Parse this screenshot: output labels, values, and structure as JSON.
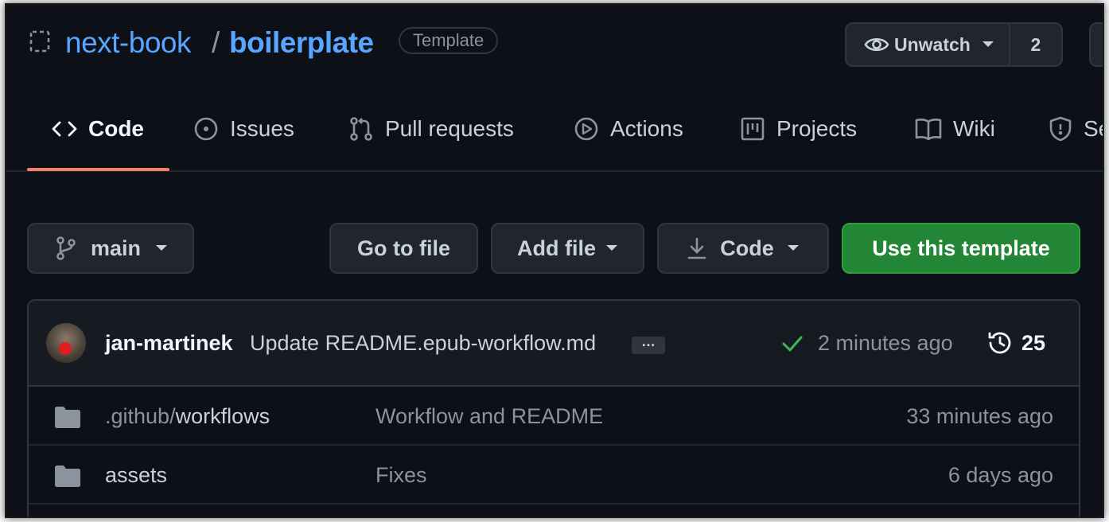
{
  "repo": {
    "owner": "next-book",
    "separator": "/",
    "name": "boilerplate",
    "badge": "Template"
  },
  "watch": {
    "label": "Unwatch",
    "count": "2"
  },
  "tabs": [
    {
      "label": "Code",
      "icon": "code-icon",
      "active": true
    },
    {
      "label": "Issues",
      "icon": "issue-icon"
    },
    {
      "label": "Pull requests",
      "icon": "pull-request-icon"
    },
    {
      "label": "Actions",
      "icon": "play-icon"
    },
    {
      "label": "Projects",
      "icon": "project-icon"
    },
    {
      "label": "Wiki",
      "icon": "book-icon"
    },
    {
      "label": "Se",
      "icon": "shield-icon"
    }
  ],
  "toolbar": {
    "branch": "main",
    "go_to_file": "Go to file",
    "add_file": "Add file",
    "code": "Code",
    "use_template": "Use this template"
  },
  "commit": {
    "author": "jan-martinek",
    "message": "Update README.epub-workflow.md",
    "ellipsis": "…",
    "time": "2 minutes ago",
    "history_count": "25"
  },
  "files": [
    {
      "name_prefix": ".github/",
      "name": "workflows",
      "message": "Workflow and README",
      "time": "33 minutes ago",
      "icon": "folder-icon"
    },
    {
      "name_prefix": "",
      "name": "assets",
      "message": "Fixes",
      "time": "6 days ago",
      "icon": "folder-icon"
    }
  ],
  "colors": {
    "background": "#0d1117",
    "link": "#58a6ff",
    "accent_underline": "#f78166",
    "primary_button": "#238636",
    "success_check": "#3fb950"
  }
}
